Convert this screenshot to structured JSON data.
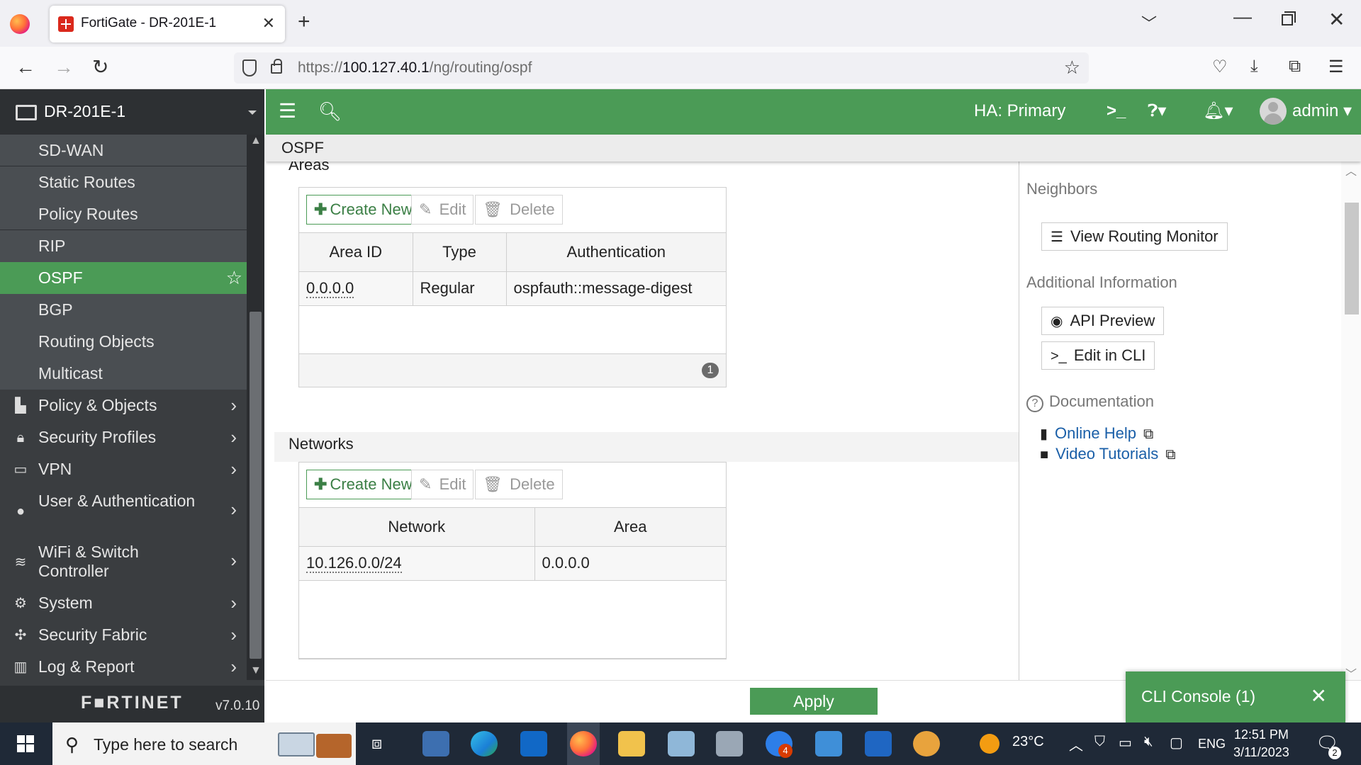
{
  "browser": {
    "tab_title": "FortiGate - DR-201E-1",
    "url_prefix": "https://",
    "url_host": "100.127.40.1",
    "url_path": "/ng/routing/ospf"
  },
  "sidebar": {
    "device": "DR-201E-1",
    "items": [
      {
        "label": "SD-WAN"
      },
      {
        "label": "Static Routes"
      },
      {
        "label": "Policy Routes"
      },
      {
        "label": "RIP"
      },
      {
        "label": "OSPF"
      },
      {
        "label": "BGP"
      },
      {
        "label": "Routing Objects"
      },
      {
        "label": "Multicast"
      },
      {
        "label": "Policy & Objects"
      },
      {
        "label": "Security Profiles"
      },
      {
        "label": "VPN"
      },
      {
        "label": "User & Authentication"
      },
      {
        "label": "WiFi & Switch Controller"
      },
      {
        "label": "System"
      },
      {
        "label": "Security Fabric"
      },
      {
        "label": "Log & Report"
      }
    ],
    "logo": "F■RTINET",
    "version": "v7.0.10"
  },
  "topbar": {
    "ha_status": "HA:  Primary",
    "user": "admin"
  },
  "page": {
    "title": "OSPF"
  },
  "areas": {
    "title": "Areas",
    "create_label": "Create New",
    "edit_label": "Edit",
    "delete_label": "Delete",
    "columns": [
      "Area ID",
      "Type",
      "Authentication"
    ],
    "rows": [
      {
        "area_id": "0.0.0.0",
        "type": "Regular",
        "auth": "ospfauth::message-digest"
      }
    ],
    "count": "1"
  },
  "networks": {
    "title": "Networks",
    "create_label": "Create New",
    "edit_label": "Edit",
    "delete_label": "Delete",
    "columns": [
      "Network",
      "Area"
    ],
    "rows": [
      {
        "network": "10.126.0.0/24",
        "area": "0.0.0.0"
      }
    ]
  },
  "rightpane": {
    "neighbors_title": "Neighbors",
    "view_monitor": "View Routing Monitor",
    "additional_title": "Additional Information",
    "api_preview": "API Preview",
    "edit_cli": "Edit in CLI",
    "documentation_title": "Documentation",
    "online_help": "Online Help",
    "video_tutorials": "Video Tutorials"
  },
  "footer": {
    "apply_label": "Apply",
    "cli_console": "CLI Console (1)"
  },
  "taskbar": {
    "search_placeholder": "Type here to search",
    "weather": "23°C",
    "language": "ENG",
    "time": "12:51 PM",
    "date": "3/11/2023",
    "notification_count": "2",
    "teams_badge": "4"
  },
  "colors": {
    "fortinet_green": "#4b9b56",
    "sidebar_bg": "#3a3d40",
    "link_blue": "#1a5fa8"
  }
}
